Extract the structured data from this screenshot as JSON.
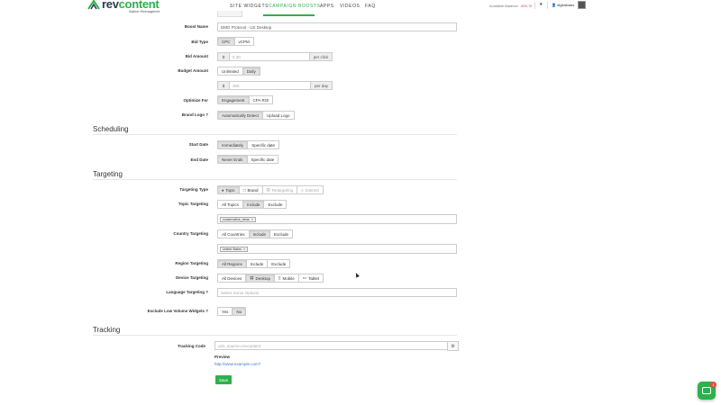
{
  "brand": {
    "name_prefix": "rev",
    "name_suffix": "content",
    "tagline": "Native Reimagined"
  },
  "nav": {
    "items": [
      "SITE WIDGETS",
      "CAMPAIGN BOOSTS",
      "APPS",
      "VIDEOS",
      "FAQ"
    ],
    "active_index": 1,
    "balance_label": "Available Balance:",
    "balance_value": "-$30.76",
    "username": "digitalbabs"
  },
  "form": {
    "boost_name_label": "Boost Name",
    "boost_name_value": "DMG Protocol - US Desktop",
    "bid_type_label": "Bid Type",
    "bid_type_options": [
      "CPC",
      "vCPM"
    ],
    "bid_amount_label": "Bid Amount",
    "bid_currency": "$",
    "bid_amount_value": "0.30",
    "bid_suffix": "per click",
    "budget_amount_label": "Budget Amount",
    "budget_options": [
      "Unlimited",
      "Daily"
    ],
    "budget_currency": "$",
    "budget_value": "300",
    "budget_suffix": "per day",
    "optimize_label": "Optimize For",
    "optimize_options": [
      "Engagement",
      "CPA ROI"
    ],
    "brand_logo_label": "Brand Logo ?",
    "brand_logo_options": [
      "Automatically Detect",
      "Upload Logo"
    ]
  },
  "scheduling": {
    "title": "Scheduling",
    "start_label": "Start Date",
    "start_options": [
      "Immediately",
      "Specific date"
    ],
    "end_label": "End Date",
    "end_options": [
      "Never Ends",
      "Specific date"
    ]
  },
  "targeting": {
    "title": "Targeting",
    "type_label": "Targeting Type",
    "type_options": [
      "Topic",
      "Brand",
      "Retargeting",
      "Interest"
    ],
    "topic_label": "Topic Targeting",
    "topic_options": [
      "All Topics",
      "Include",
      "Exclude"
    ],
    "topic_tag": "conservative_news",
    "country_label": "Country Targeting",
    "country_options": [
      "All Countries",
      "Include",
      "Exclude"
    ],
    "country_tag": "United States",
    "region_label": "Region Targeting",
    "region_options": [
      "All Regions",
      "Include",
      "Exclude"
    ],
    "device_label": "Device Targeting",
    "device_options": [
      "All Devices",
      "Desktop",
      "Mobile",
      "Tablet"
    ],
    "language_label": "Language Targeting ?",
    "language_placeholder": "Select Some Options",
    "low_volume_label": "Exclude Low Volume Widgets ?",
    "low_volume_options": [
      "Yes",
      "No"
    ]
  },
  "tracking": {
    "title": "Tracking",
    "code_label": "Tracking Code",
    "code_placeholder": "utm_source=revcontent",
    "preview_label": "Preview",
    "preview_url": "http://www.example.com?",
    "save_label": "Save"
  },
  "chat": {
    "badge": "1"
  },
  "colors": {
    "accent": "#2db14b",
    "balance": "#d9534f",
    "link": "#3a7bc8"
  }
}
